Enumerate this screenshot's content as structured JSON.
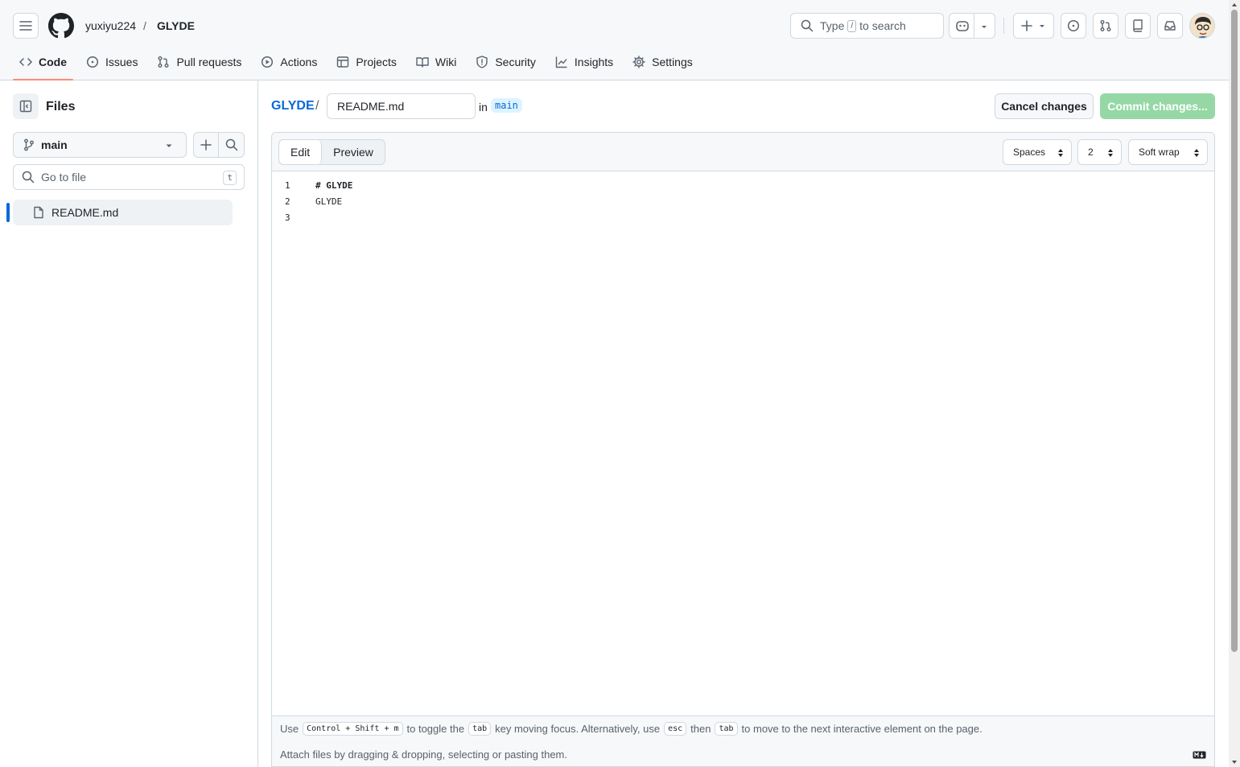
{
  "header": {
    "owner": "yuxiyu224",
    "separator": "/",
    "repo": "GLYDE",
    "search": {
      "prefix": "Type",
      "key": "/",
      "suffix": "to search"
    }
  },
  "tabs": [
    {
      "label": "Code",
      "icon": "code-icon",
      "active": true
    },
    {
      "label": "Issues",
      "icon": "issue-opened-icon"
    },
    {
      "label": "Pull requests",
      "icon": "git-pull-request-icon"
    },
    {
      "label": "Actions",
      "icon": "play-icon"
    },
    {
      "label": "Projects",
      "icon": "table-icon"
    },
    {
      "label": "Wiki",
      "icon": "book-icon"
    },
    {
      "label": "Security",
      "icon": "shield-icon"
    },
    {
      "label": "Insights",
      "icon": "graph-icon"
    },
    {
      "label": "Settings",
      "icon": "gear-icon"
    }
  ],
  "sidebar": {
    "title": "Files",
    "branch": "main",
    "go_to_file_placeholder": "Go to file",
    "go_to_file_shortcut": "t",
    "files": [
      {
        "name": "README.md"
      }
    ]
  },
  "editor_header": {
    "repo_link": "GLYDE",
    "separator": "/",
    "filename": "README.md",
    "in_label": "in",
    "branch": "main",
    "cancel_label": "Cancel changes",
    "commit_label": "Commit changes..."
  },
  "editor": {
    "edit_tab": "Edit",
    "preview_tab": "Preview",
    "indent_mode": "Spaces",
    "indent_size": "2",
    "wrap_mode": "Soft wrap",
    "lines": [
      {
        "num": "1",
        "text": "# GLYDE"
      },
      {
        "num": "2",
        "text": "GLYDE"
      },
      {
        "num": "3",
        "text": ""
      }
    ],
    "hint": {
      "t1": "Use",
      "k1": "Control + Shift + m",
      "t2": "to toggle the",
      "k2": "tab",
      "t3": "key moving focus. Alternatively, use",
      "k3": "esc",
      "t4": "then",
      "k4": "tab",
      "t5": "to move to the next interactive element on the page."
    },
    "attach_text": "Attach files by dragging & dropping, selecting or pasting them."
  },
  "colors": {
    "accent": "#0969da",
    "active_tab_underline": "#fd8c73",
    "commit_disabled": "#95d8a6"
  }
}
